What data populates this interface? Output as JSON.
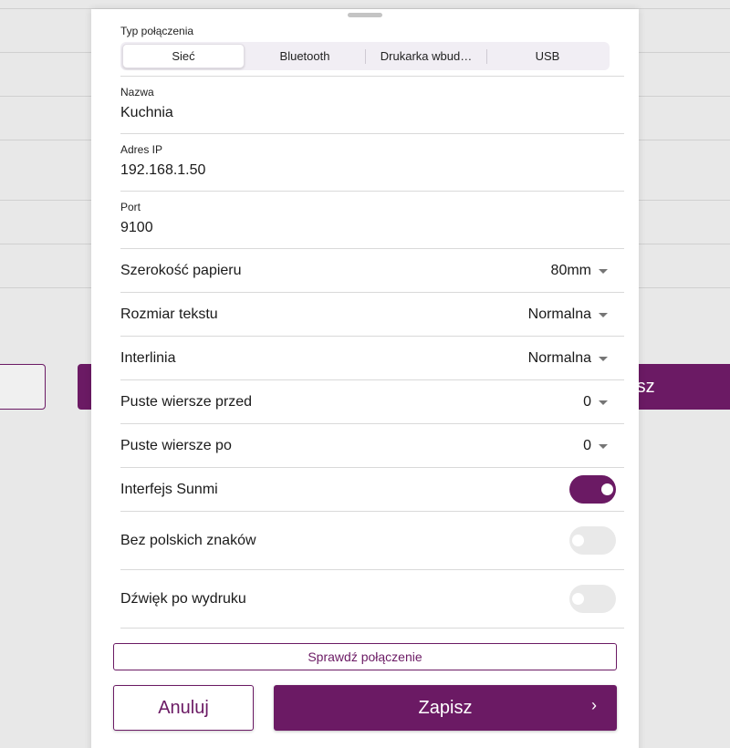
{
  "background": {
    "right_button_label": "pisz"
  },
  "connection": {
    "label": "Typ połączenia",
    "tabs": [
      {
        "label": "Sieć",
        "active": true
      },
      {
        "label": "Bluetooth",
        "active": false
      },
      {
        "label": "Drukarka wbud…",
        "active": false
      },
      {
        "label": "USB",
        "active": false
      }
    ]
  },
  "fields": {
    "name": {
      "label": "Nazwa",
      "value": "Kuchnia"
    },
    "ip": {
      "label": "Adres IP",
      "value": "192.168.1.50"
    },
    "port": {
      "label": "Port",
      "value": "9100"
    }
  },
  "selects": {
    "paper_width": {
      "label": "Szerokość papieru",
      "value": "80mm"
    },
    "text_size": {
      "label": "Rozmiar tekstu",
      "value": "Normalna"
    },
    "line_spacing": {
      "label": "Interlinia",
      "value": "Normalna"
    },
    "blank_before": {
      "label": "Puste wiersze przed",
      "value": "0"
    },
    "blank_after": {
      "label": "Puste wiersze po",
      "value": "0"
    }
  },
  "toggles": {
    "sunmi": {
      "label": "Interfejs Sunmi",
      "on": true
    },
    "no_polish": {
      "label": "Bez polskich znaków",
      "on": false
    },
    "sound": {
      "label": "Dźwięk po wydruku",
      "on": false
    }
  },
  "actions": {
    "check_label": "Sprawdź połączenie",
    "cancel_label": "Anuluj",
    "save_label": "Zapisz",
    "save_chevron": "›"
  },
  "colors": {
    "accent": "#6b1a64"
  }
}
